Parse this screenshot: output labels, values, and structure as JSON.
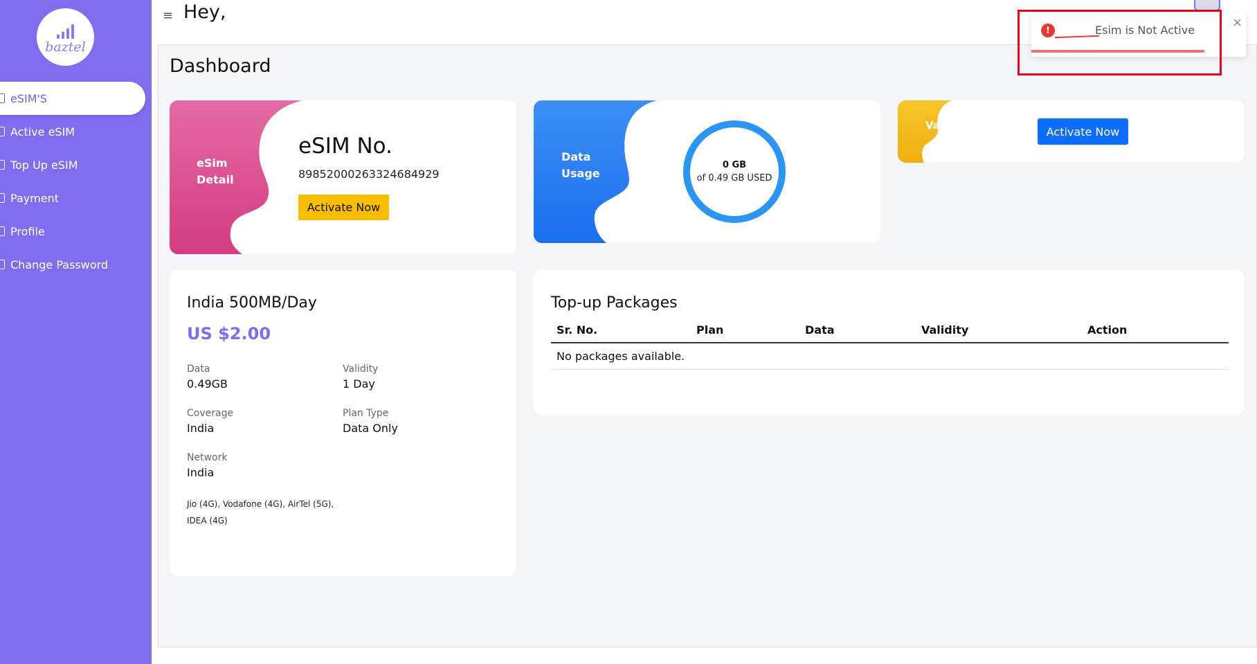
{
  "header": {
    "greeting": "Hey,",
    "menu_icon": "≡"
  },
  "sidebar": {
    "brand": "baztel",
    "items": [
      {
        "label": "eSIM'S"
      },
      {
        "label": "Active eSIM"
      },
      {
        "label": "Top Up eSIM"
      },
      {
        "label": "Payment"
      },
      {
        "label": "Profile"
      },
      {
        "label": "Change Password"
      }
    ]
  },
  "main": {
    "title": "Dashboard",
    "esim_card": {
      "label_line1": "eSim",
      "label_line2": "Detail",
      "heading": "eSIM No.",
      "number": "89852000263324684929",
      "button": "Activate Now"
    },
    "usage_card": {
      "label_line1": "Data",
      "label_line2": "Usage",
      "used": "0 GB",
      "of_total": "of 0.49 GB USED"
    },
    "validity_card": {
      "label": "Va",
      "button": "Activate Now"
    },
    "plan_card": {
      "name": "India 500MB/Day",
      "price": "US $2.00",
      "data_label": "Data",
      "data_value": "0.49GB",
      "validity_label": "Validity",
      "validity_value": "1 Day",
      "coverage_label": "Coverage",
      "coverage_value": "India",
      "plantype_label": "Plan Type",
      "plantype_value": "Data Only",
      "network_label": "Network",
      "network_value": "India",
      "network_detail": "Jio (4G), Vodafone (4G), AirTel (5G), IDEA (4G)"
    },
    "topup_card": {
      "title": "Top-up Packages",
      "columns": [
        "Sr. No.",
        "Plan",
        "Data",
        "Validity",
        "Action"
      ],
      "empty": "No packages available."
    }
  },
  "toast": {
    "message": "Esim is Not Active",
    "icon": "!",
    "close": "×"
  },
  "colors": {
    "sidebar": "#7f6df0",
    "accent": "#7f6df0",
    "yellow_button": "#f9bd00",
    "blue_button": "#0d6efd",
    "ring": "#2a96f2",
    "error": "#e53935"
  }
}
